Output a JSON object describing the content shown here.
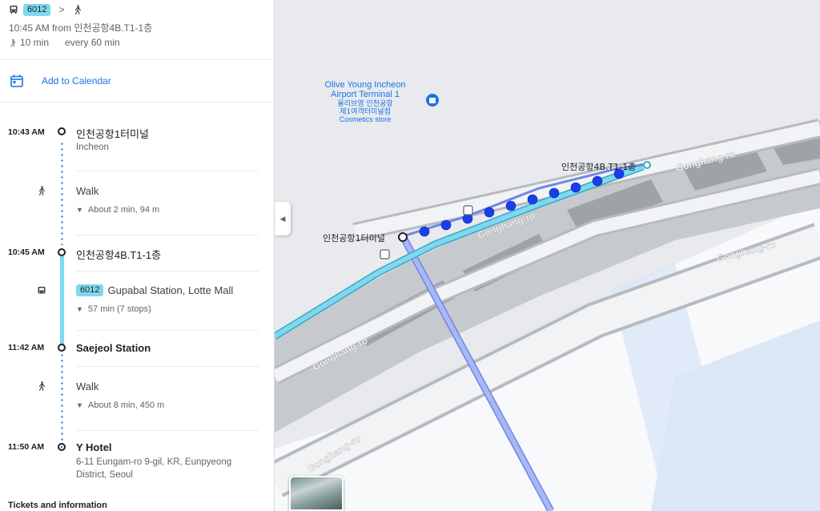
{
  "summary": {
    "route_badge": "6012",
    "chevron": ">",
    "depart_line": "10:45 AM from 인천공항4B.T1-1층",
    "walk_time": "10 min",
    "frequency": "every 60 min",
    "icons": [
      "bus-icon",
      "walk-icon"
    ]
  },
  "calendar": {
    "label": "Add to Calendar",
    "icon": "calendar-icon"
  },
  "steps": {
    "origin": {
      "time": "10:43 AM",
      "name": "인천공항1터미널",
      "sub": "Incheon"
    },
    "walk1": {
      "label": "Walk",
      "detail": "About 2 min, 94 m"
    },
    "board": {
      "time": "10:45 AM",
      "name": "인천공항4B.T1-1층"
    },
    "bus": {
      "badge": "6012",
      "headsign": "Gupabal Station, Lotte Mall",
      "detail": "57 min (7 stops)"
    },
    "alight": {
      "time": "11:42 AM",
      "name": "Saejeol Station"
    },
    "walk2": {
      "label": "Walk",
      "detail": "About 8 min, 450 m"
    },
    "destination": {
      "time": "11:50 AM",
      "name": "Y Hotel",
      "address": "6-11 Eungam-ro 9-gil, KR, Eunpyeong District, Seoul"
    }
  },
  "tickets_label": "Tickets and information",
  "map": {
    "poi": {
      "name_line1": "Olive Young Incheon",
      "name_line2": "Airport Terminal 1",
      "korean_line1": "올리브영 인천공항",
      "korean_line2": "제1여객터미널점",
      "category": "Cosmetics store"
    },
    "stop_label_1": "인천공항4B.T1-1층",
    "stop_label_2": "인천공항1터미널",
    "road_labels": [
      "Gonghang-ro",
      "Gonghang-ro",
      "Gonghang-ro",
      "Gonghang-ro",
      "Gonghang-ro"
    ],
    "colors": {
      "bus_route": "#7fd8ee",
      "walk_dots": "#1a3ee8",
      "rail": "#8ea4f0",
      "road": "#9aa0a6",
      "land": "#e8eaed",
      "water": "#dbe6f7"
    }
  },
  "collapse_button": "◀"
}
